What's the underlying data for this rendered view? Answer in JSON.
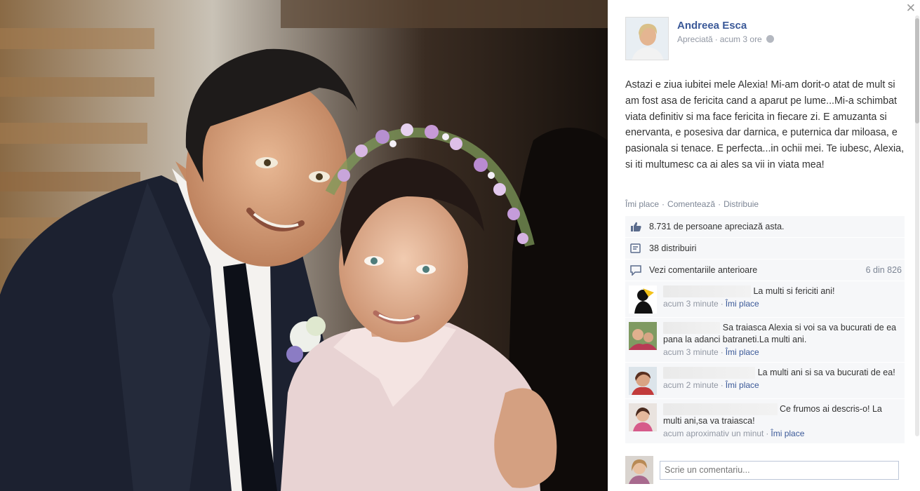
{
  "photo": {
    "description_icon": "photo-man-and-girl"
  },
  "panel": {
    "close_label": "✕",
    "author": {
      "name": "Andreea Esca",
      "category": "Apreciată",
      "time": "acum 3 ore",
      "privacy_icon": "globe-icon"
    },
    "post_text": "Astazi e ziua iubitei mele Alexia! Mi-am dorit-o atat de mult si am fost asa de fericita cand a aparut pe lume...Mi-a schimbat viata definitiv si ma face fericita in fiecare zi. E amuzanta si enervanta, e posesiva dar darnica, e puternica dar miloasa, e pasionala si tenace. E perfecta...in ochii mei. Te iubesc, Alexia, si iti multumesc ca ai ales sa vii in viata mea!",
    "actions": {
      "like": "Îmi place",
      "comment": "Comentează",
      "share": "Distribuie"
    },
    "likes_text": "8.731 de persoane apreciază asta.",
    "shares_text": "38 distribuiri",
    "view_previous": "Vezi comentariile anterioare",
    "comment_count": "6 din 826",
    "comments": [
      {
        "text": "La multi si fericiti ani!",
        "time": "acum 3 minute",
        "like": "Îmi place"
      },
      {
        "text": "Sa traiasca Alexia si voi sa va bucurati de ea pana la adanci batraneti.La multi ani.",
        "time": "acum 3 minute",
        "like": "Îmi place"
      },
      {
        "text": "La multi ani si sa va bucurati de ea!",
        "time": "acum 2 minute",
        "like": "Îmi place"
      },
      {
        "text": "Ce frumos ai descris-o! La multi ani,sa va traiasca!",
        "time": "acum aproximativ un minut",
        "like": "Îmi place"
      }
    ],
    "comment_placeholder": "Scrie un comentariu..."
  },
  "colors": {
    "link": "#3b5998",
    "meta": "#9197a3",
    "row_bg": "#f6f7f9"
  }
}
